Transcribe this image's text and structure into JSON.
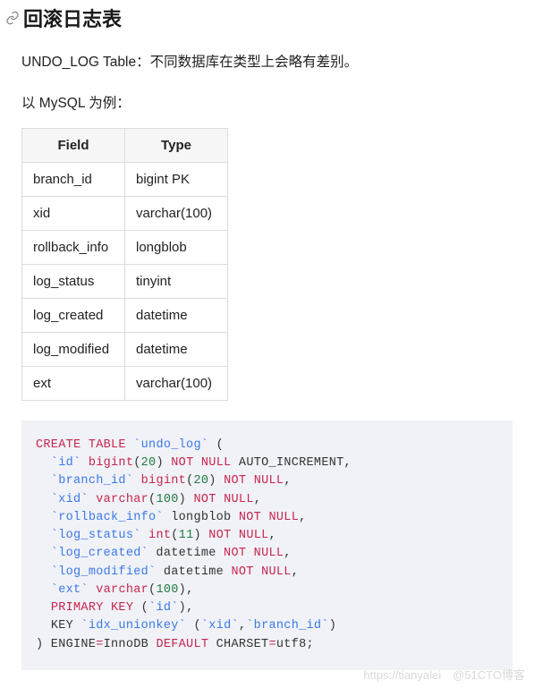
{
  "heading": "回滚日志表",
  "intro": "UNDO_LOG Table：不同数据库在类型上会略有差别。",
  "example_line": "以 MySQL 为例：",
  "table": {
    "headers": [
      "Field",
      "Type"
    ],
    "rows": [
      [
        "branch_id",
        "bigint PK"
      ],
      [
        "xid",
        "varchar(100)"
      ],
      [
        "rollback_info",
        "longblob"
      ],
      [
        "log_status",
        "tinyint"
      ],
      [
        "log_created",
        "datetime"
      ],
      [
        "log_modified",
        "datetime"
      ],
      [
        "ext",
        "varchar(100)"
      ]
    ]
  },
  "sql": [
    {
      "t": "kw",
      "v": "CREATE"
    },
    {
      "t": "sp",
      "v": " "
    },
    {
      "t": "kw",
      "v": "TABLE"
    },
    {
      "t": "sp",
      "v": " "
    },
    {
      "t": "str",
      "v": "`undo_log`"
    },
    {
      "t": "sp",
      "v": " ("
    },
    {
      "t": "nl"
    },
    {
      "t": "in"
    },
    {
      "t": "str",
      "v": "`id`"
    },
    {
      "t": "sp",
      "v": " "
    },
    {
      "t": "kw",
      "v": "bigint"
    },
    {
      "t": "p",
      "v": "("
    },
    {
      "t": "num",
      "v": "20"
    },
    {
      "t": "p",
      "v": ") "
    },
    {
      "t": "kw",
      "v": "NOT"
    },
    {
      "t": "sp",
      "v": " "
    },
    {
      "t": "kw",
      "v": "NULL"
    },
    {
      "t": "sp",
      "v": " AUTO_INCREMENT,"
    },
    {
      "t": "nl"
    },
    {
      "t": "in"
    },
    {
      "t": "str",
      "v": "`branch_id`"
    },
    {
      "t": "sp",
      "v": " "
    },
    {
      "t": "kw",
      "v": "bigint"
    },
    {
      "t": "p",
      "v": "("
    },
    {
      "t": "num",
      "v": "20"
    },
    {
      "t": "p",
      "v": ") "
    },
    {
      "t": "kw",
      "v": "NOT"
    },
    {
      "t": "sp",
      "v": " "
    },
    {
      "t": "kw",
      "v": "NULL"
    },
    {
      "t": "p",
      "v": ","
    },
    {
      "t": "nl"
    },
    {
      "t": "in"
    },
    {
      "t": "str",
      "v": "`xid`"
    },
    {
      "t": "sp",
      "v": " "
    },
    {
      "t": "kw",
      "v": "varchar"
    },
    {
      "t": "p",
      "v": "("
    },
    {
      "t": "num",
      "v": "100"
    },
    {
      "t": "p",
      "v": ") "
    },
    {
      "t": "kw",
      "v": "NOT"
    },
    {
      "t": "sp",
      "v": " "
    },
    {
      "t": "kw",
      "v": "NULL"
    },
    {
      "t": "p",
      "v": ","
    },
    {
      "t": "nl"
    },
    {
      "t": "in"
    },
    {
      "t": "str",
      "v": "`rollback_info`"
    },
    {
      "t": "sp",
      "v": " longblob "
    },
    {
      "t": "kw",
      "v": "NOT"
    },
    {
      "t": "sp",
      "v": " "
    },
    {
      "t": "kw",
      "v": "NULL"
    },
    {
      "t": "p",
      "v": ","
    },
    {
      "t": "nl"
    },
    {
      "t": "in"
    },
    {
      "t": "str",
      "v": "`log_status`"
    },
    {
      "t": "sp",
      "v": " "
    },
    {
      "t": "kw",
      "v": "int"
    },
    {
      "t": "p",
      "v": "("
    },
    {
      "t": "num",
      "v": "11"
    },
    {
      "t": "p",
      "v": ") "
    },
    {
      "t": "kw",
      "v": "NOT"
    },
    {
      "t": "sp",
      "v": " "
    },
    {
      "t": "kw",
      "v": "NULL"
    },
    {
      "t": "p",
      "v": ","
    },
    {
      "t": "nl"
    },
    {
      "t": "in"
    },
    {
      "t": "str",
      "v": "`log_created`"
    },
    {
      "t": "sp",
      "v": " datetime "
    },
    {
      "t": "kw",
      "v": "NOT"
    },
    {
      "t": "sp",
      "v": " "
    },
    {
      "t": "kw",
      "v": "NULL"
    },
    {
      "t": "p",
      "v": ","
    },
    {
      "t": "nl"
    },
    {
      "t": "in"
    },
    {
      "t": "str",
      "v": "`log_modified`"
    },
    {
      "t": "sp",
      "v": " datetime "
    },
    {
      "t": "kw",
      "v": "NOT"
    },
    {
      "t": "sp",
      "v": " "
    },
    {
      "t": "kw",
      "v": "NULL"
    },
    {
      "t": "p",
      "v": ","
    },
    {
      "t": "nl"
    },
    {
      "t": "in"
    },
    {
      "t": "str",
      "v": "`ext`"
    },
    {
      "t": "sp",
      "v": " "
    },
    {
      "t": "kw",
      "v": "varchar"
    },
    {
      "t": "p",
      "v": "("
    },
    {
      "t": "num",
      "v": "100"
    },
    {
      "t": "p",
      "v": "),"
    },
    {
      "t": "nl"
    },
    {
      "t": "in"
    },
    {
      "t": "kw",
      "v": "PRIMARY"
    },
    {
      "t": "sp",
      "v": " "
    },
    {
      "t": "kw",
      "v": "KEY"
    },
    {
      "t": "sp",
      "v": " ("
    },
    {
      "t": "str",
      "v": "`id`"
    },
    {
      "t": "p",
      "v": "),"
    },
    {
      "t": "nl"
    },
    {
      "t": "in"
    },
    {
      "t": "sp",
      "v": "KEY "
    },
    {
      "t": "str",
      "v": "`idx_unionkey`"
    },
    {
      "t": "sp",
      "v": " ("
    },
    {
      "t": "str",
      "v": "`xid`"
    },
    {
      "t": "p",
      "v": ","
    },
    {
      "t": "str",
      "v": "`branch_id`"
    },
    {
      "t": "p",
      "v": ")"
    },
    {
      "t": "nl"
    },
    {
      "t": "sp",
      "v": ") ENGINE"
    },
    {
      "t": "kw",
      "v": "="
    },
    {
      "t": "sp",
      "v": "InnoDB "
    },
    {
      "t": "kw",
      "v": "DEFAULT"
    },
    {
      "t": "sp",
      "v": " CHARSET"
    },
    {
      "t": "kw",
      "v": "="
    },
    {
      "t": "sp",
      "v": "utf8;"
    }
  ],
  "watermark": "https://tianyalei　@51CTO博客"
}
